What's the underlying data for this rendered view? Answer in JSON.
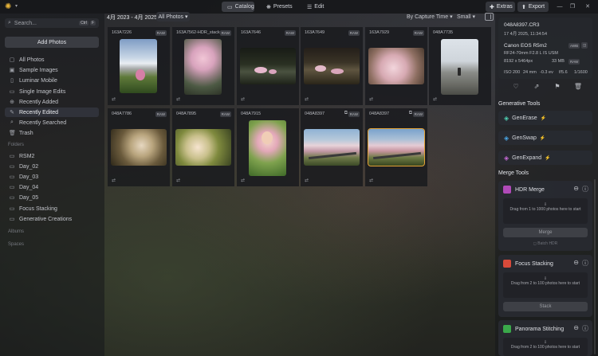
{
  "topbar": {
    "tabs": [
      {
        "label": "Catalog",
        "icon": "folder-icon"
      },
      {
        "label": "Presets",
        "icon": "presets-icon"
      },
      {
        "label": "Edit",
        "icon": "sliders-icon"
      }
    ],
    "extras_label": "Extras",
    "export_label": "Export"
  },
  "sidebar": {
    "search_placeholder": "Search...",
    "search_shortcut": [
      "Ctrl",
      "F"
    ],
    "add_photos_label": "Add Photos",
    "library": [
      {
        "label": "All Photos",
        "icon": "photos-icon"
      },
      {
        "label": "Sample Images",
        "icon": "image-icon"
      },
      {
        "label": "Luminar Mobile",
        "icon": "mobile-icon"
      },
      {
        "label": "Single Image Edits",
        "icon": "single-image-icon"
      },
      {
        "label": "Recently Added",
        "icon": "recent-added-icon"
      },
      {
        "label": "Recently Edited",
        "icon": "recent-edited-icon",
        "active": true
      },
      {
        "label": "Recently Searched",
        "icon": "search-history-icon"
      },
      {
        "label": "Trash",
        "icon": "trash-icon"
      }
    ],
    "folders_title": "Folders",
    "folders": [
      "RSM2",
      "Day_02",
      "Day_03",
      "Day_04",
      "Day_05",
      "Focus Stacking",
      "Generative Creations"
    ],
    "albums_title": "Albums",
    "spaces_title": "Spaces"
  },
  "main": {
    "date_range": "4月 2023 - 4月 2025",
    "filter": "All Photos",
    "sort": "By Capture Time",
    "size": "Small",
    "tiles": [
      {
        "name": "163A7226",
        "raw": true,
        "stack": false,
        "selected": false
      },
      {
        "name": "163A7562-HDR_stack",
        "raw": true,
        "stack": false,
        "selected": false
      },
      {
        "name": "163A7646",
        "raw": true,
        "stack": false,
        "selected": false
      },
      {
        "name": "163A7649",
        "raw": true,
        "stack": false,
        "selected": false
      },
      {
        "name": "163A7929",
        "raw": true,
        "stack": false,
        "selected": false
      },
      {
        "name": "048A7735",
        "raw": false,
        "stack": false,
        "selected": false
      },
      {
        "name": "048A7786",
        "raw": true,
        "stack": false,
        "selected": false
      },
      {
        "name": "048A7895",
        "raw": true,
        "stack": false,
        "selected": false
      },
      {
        "name": "048A7915",
        "raw": false,
        "stack": false,
        "selected": false
      },
      {
        "name": "048A8397",
        "raw": true,
        "stack": true,
        "selected": false
      },
      {
        "name": "048A8397",
        "raw": true,
        "stack": true,
        "selected": true
      }
    ],
    "raw_badge": "RAW"
  },
  "info": {
    "filename": "048A8397.CR3",
    "datetime": "17 4月 2025, 11:34:54",
    "camera": "Canon EOS R5m2",
    "lens": "RF24-70mm F2.8 L IS USM",
    "resolution": "8192 x 5464px",
    "filesize": "33 MB",
    "iso": "ISO 200",
    "focal": "24 mm",
    "ev": "-0.3 ev",
    "aperture": "f/5.6",
    "shutter": "1/1600",
    "awb": "AWB"
  },
  "generative": {
    "title": "Generative Tools",
    "tools": [
      {
        "label": "GenErase",
        "icon": "eraser-icon",
        "color": "#4fd2b4"
      },
      {
        "label": "GenSwap",
        "icon": "swap-icon",
        "color": "#4aa8e8"
      },
      {
        "label": "GenExpand",
        "icon": "expand-icon",
        "color": "#c86ad8"
      }
    ]
  },
  "merge": {
    "title": "Merge Tools",
    "tools": [
      {
        "label": "HDR Merge",
        "icon": "hdr-icon",
        "color": "#b04ab8",
        "drop": "Drag from 1 to 1000 photos here to start",
        "button": "Merge",
        "option": "Batch HDR"
      },
      {
        "label": "Focus Stacking",
        "icon": "focus-stack-icon",
        "color": "#d84a3a",
        "drop": "Drag from 2 to 100 photos here to start",
        "button": "Stack"
      },
      {
        "label": "Panorama Stitching",
        "icon": "panorama-icon",
        "color": "#3aa84a",
        "drop": "Drag from 2 to 100 photos here to start"
      }
    ]
  }
}
